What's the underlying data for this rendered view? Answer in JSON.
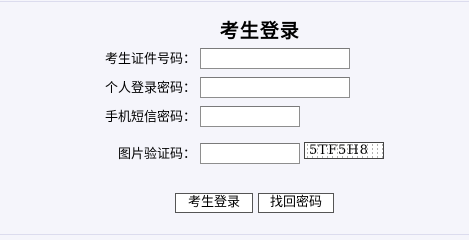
{
  "form": {
    "title": "考生登录",
    "fields": [
      {
        "label": "考生证件号码：",
        "value": ""
      },
      {
        "label": "个人登录密码：",
        "value": ""
      },
      {
        "label": "手机短信密码：",
        "value": ""
      },
      {
        "label": "图片验证码：",
        "value": ""
      }
    ],
    "captcha_text": "5TF5H8"
  },
  "buttons": {
    "login_label": "考生登录",
    "recover_label": "找回密码"
  }
}
